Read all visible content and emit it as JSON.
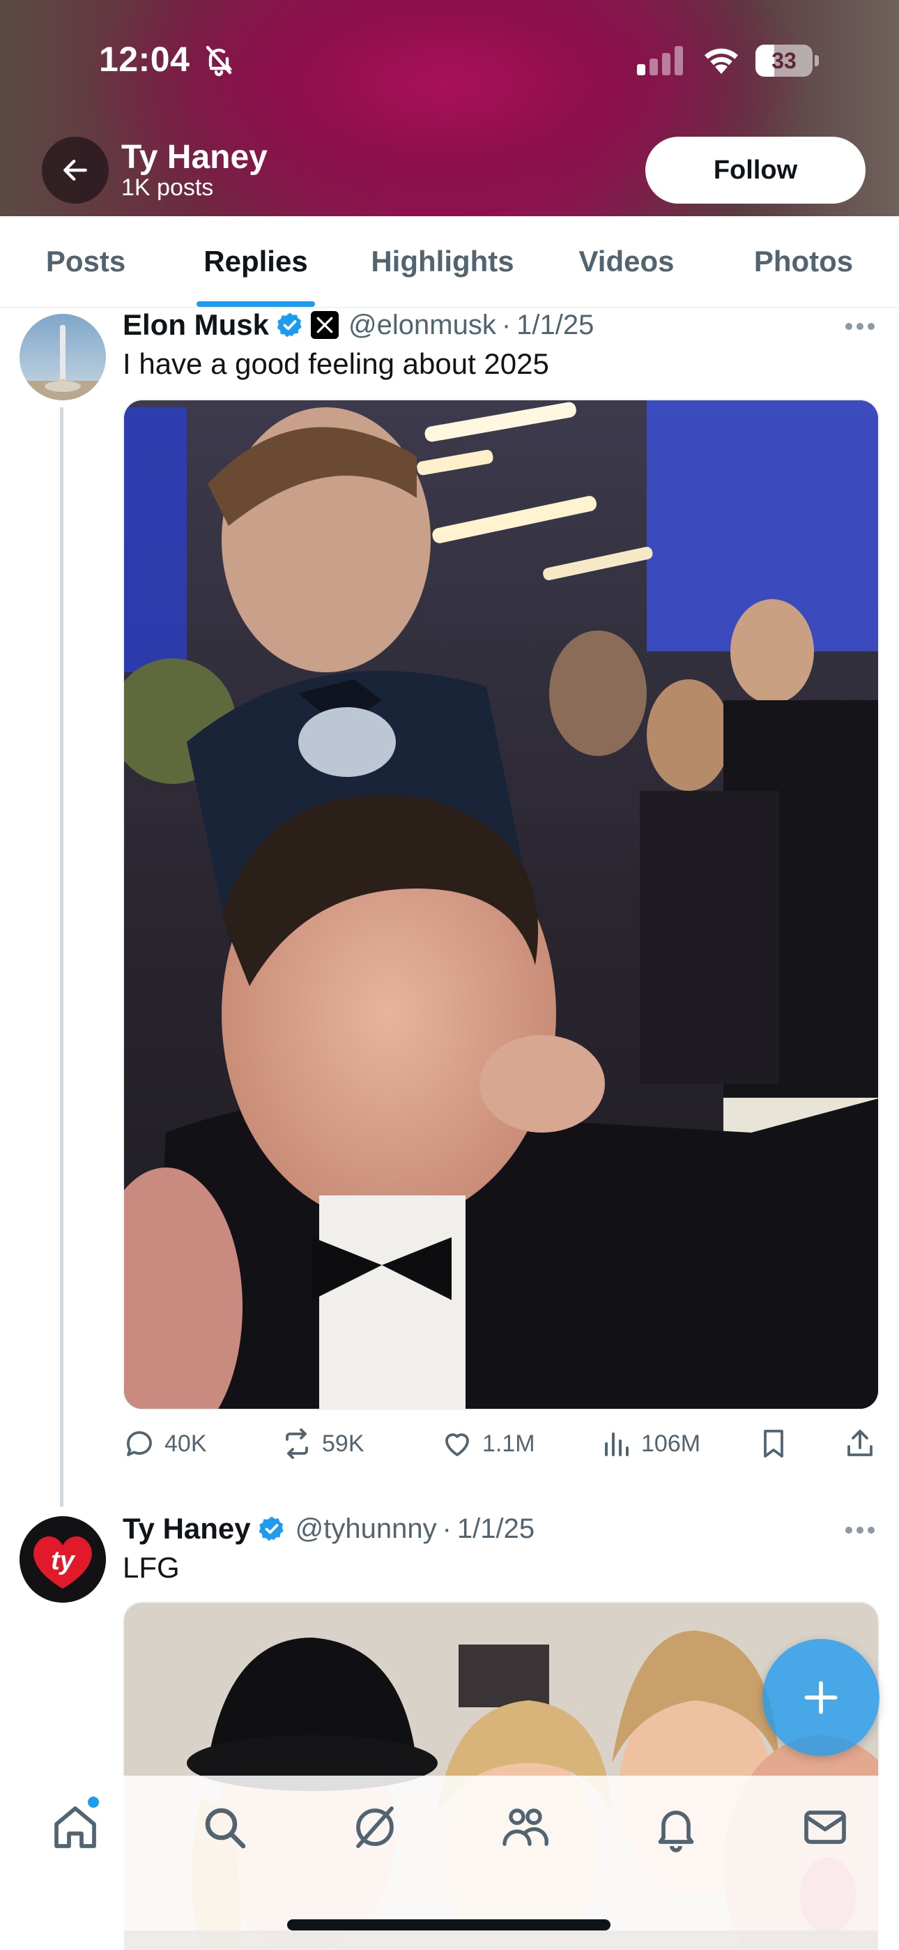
{
  "status_bar": {
    "time": "12:04",
    "battery_level": "33",
    "battery_fraction": 0.33
  },
  "profile_header": {
    "name": "Ty Haney",
    "post_count": "1K posts",
    "follow_label": "Follow"
  },
  "tabs": [
    {
      "label": "Posts",
      "active": false
    },
    {
      "label": "Replies",
      "active": true
    },
    {
      "label": "Highlights",
      "active": false
    },
    {
      "label": "Videos",
      "active": false
    },
    {
      "label": "Photos",
      "active": false
    }
  ],
  "posts": [
    {
      "author": "Elon Musk",
      "verified": true,
      "affiliate_badge": "X",
      "handle": "@elonmusk",
      "separator": "·",
      "date": "1/1/25",
      "text": "I have a good feeling about 2025",
      "media": "photo",
      "metrics": {
        "replies": "40K",
        "reposts": "59K",
        "likes": "1.1M",
        "views": "106M"
      }
    },
    {
      "author": "Ty Haney",
      "verified": true,
      "handle": "@tyhunnny",
      "separator": "·",
      "date": "1/1/25",
      "text": "LFG",
      "media": "photo"
    }
  ],
  "icons": {
    "status": [
      "bell-off-icon",
      "signal-icon",
      "wifi-icon",
      "battery-icon"
    ],
    "header": [
      "back-arrow-icon"
    ],
    "actions": [
      "reply-icon",
      "repost-icon",
      "like-icon",
      "views-icon",
      "bookmark-icon",
      "share-icon"
    ],
    "nav": [
      "home-icon",
      "search-icon",
      "grok-icon",
      "communities-icon",
      "notifications-icon",
      "messages-icon"
    ],
    "fab": "plus-icon"
  },
  "colors": {
    "accent": "#1d9bf0",
    "text_primary": "#0f1419",
    "text_secondary": "#536471",
    "header_gradient": "#8d1550",
    "divider": "#eff3f4",
    "thread_line": "#cfd9de"
  }
}
